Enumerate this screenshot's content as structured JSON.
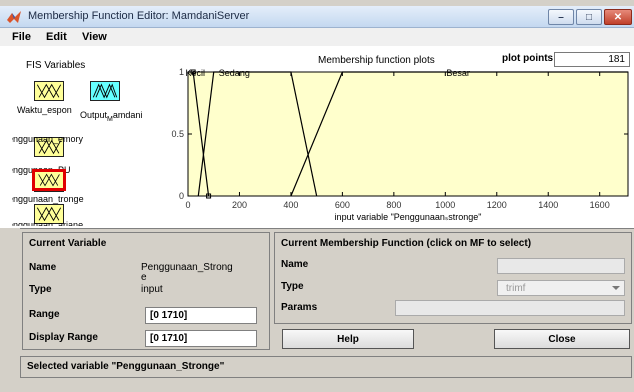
{
  "window": {
    "title": "Membership Function Editor: MamdaniServer",
    "minimize_glyph": "–",
    "maximize_glyph": "□",
    "close_glyph": "✕"
  },
  "menu": [
    "File",
    "Edit",
    "View"
  ],
  "fis": {
    "title": "FIS Variables",
    "inputs": [
      {
        "label": "Waktu_espon"
      },
      {
        "label": "enggunaan_emory"
      },
      {
        "label": "enggunaan_PU"
      },
      {
        "label": "enggunaan_tronge",
        "selected": true
      },
      {
        "label": "enggunaan_ariane"
      }
    ],
    "output": {
      "label": "Output_amdani",
      "subscript": "M"
    }
  },
  "plot_header": {
    "title": "Membership function plots",
    "points_label": "plot points:",
    "points_value": "181"
  },
  "chart_data": {
    "type": "line",
    "xlabel": "input variable \"Penggunaan_Stronge\"",
    "xlabel_display": "input variable \"Penggunaanₛstronge\"",
    "xlim": [
      0,
      1710
    ],
    "ylim": [
      0,
      1
    ],
    "xticks": [
      0,
      200,
      400,
      600,
      800,
      1000,
      1200,
      1400,
      1600
    ],
    "yticks": [
      0,
      0.5,
      1
    ],
    "line_color": "#000000",
    "plot_bg": "#ffffcc",
    "series": [
      {
        "name": "Kecil",
        "x": [
          0,
          20,
          80
        ],
        "y": [
          1,
          1,
          0
        ]
      },
      {
        "name": "Sedang",
        "x": [
          40,
          100,
          400,
          500
        ],
        "y": [
          0,
          1,
          1,
          0
        ]
      },
      {
        "name": "Besar",
        "x": [
          400,
          600,
          1710
        ],
        "y": [
          0,
          1,
          1
        ]
      }
    ],
    "label_positions": [
      {
        "text": "Kecil",
        "x": 28
      },
      {
        "text": "Sedang",
        "x": 180
      },
      {
        "text": "Besar",
        "x": 1050
      }
    ]
  },
  "current_variable": {
    "header": "Current Variable",
    "name_label": "Name",
    "name_value": "Penggunaan_Strong",
    "name_value_overflow": "e",
    "type_label": "Type",
    "type_value": "input",
    "range_label": "Range",
    "range_value": "[0 1710]",
    "display_range_label": "Display Range",
    "display_range_value": "[0 1710]"
  },
  "current_mf": {
    "header": "Current Membership Function (click on MF to select)",
    "name_label": "Name",
    "name_value": "",
    "type_label": "Type",
    "type_value": "trimf",
    "params_label": "Params",
    "params_value": ""
  },
  "buttons": {
    "help": "Help",
    "close": "Close"
  },
  "status": "Selected variable \"Penggunaan_Stronge\""
}
